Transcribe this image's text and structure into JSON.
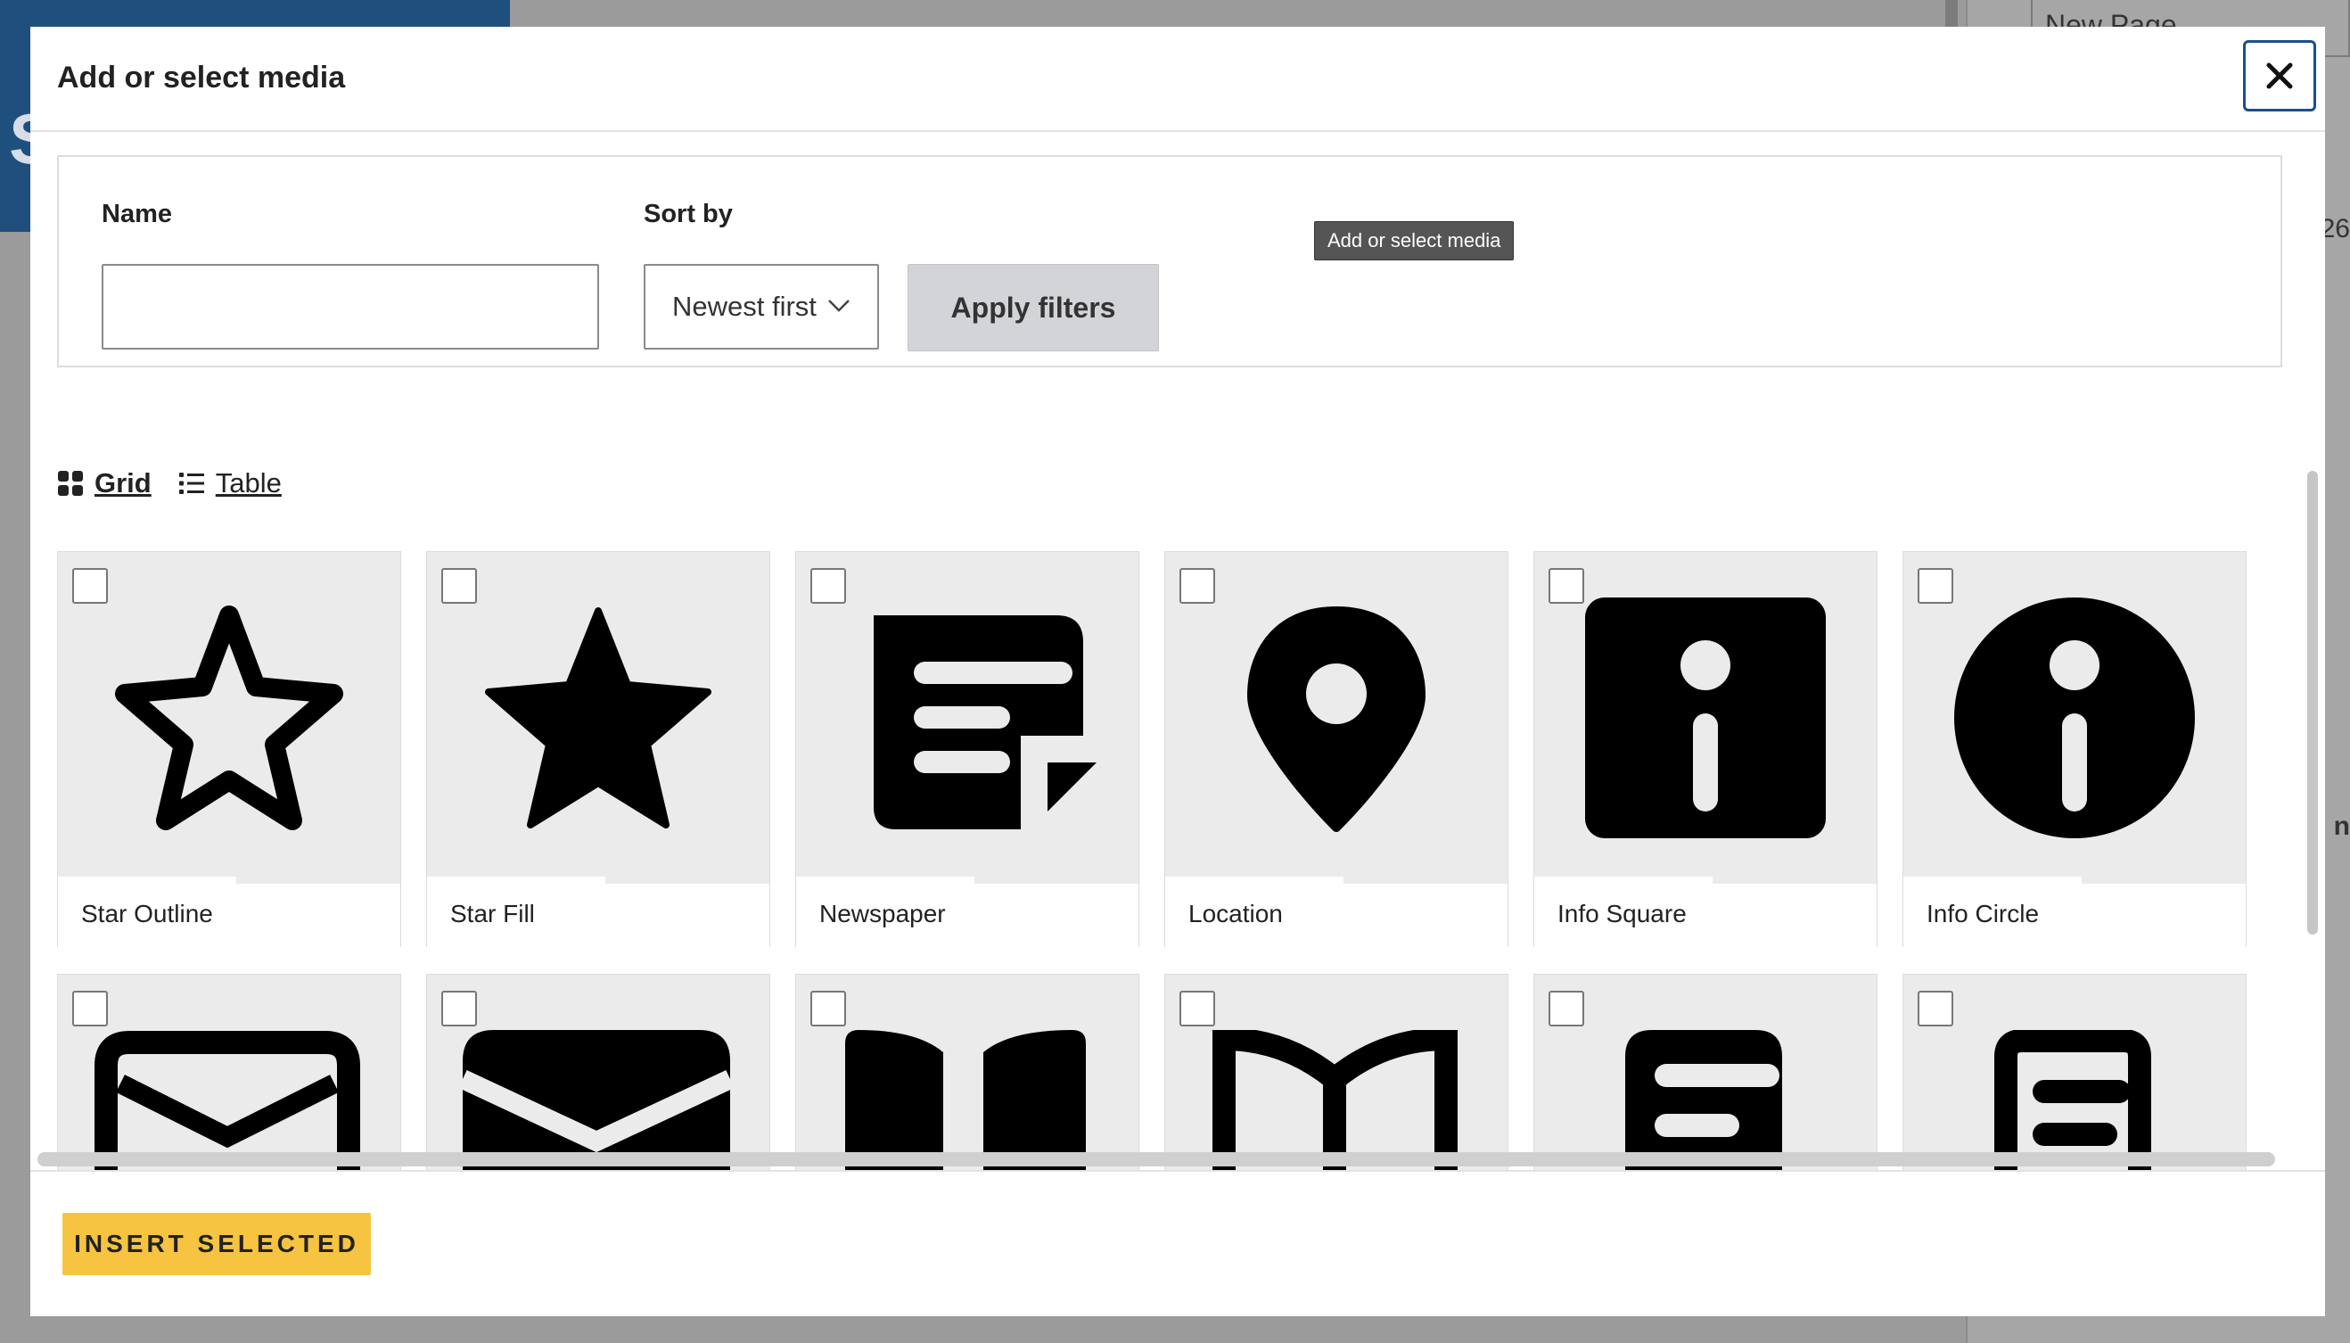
{
  "background": {
    "hero_letter": "S",
    "sidebar_tab": "New Page",
    "number_fragment": "26",
    "letter_fragment": "n"
  },
  "modal": {
    "title": "Add or select media",
    "close_label": "Close"
  },
  "filters": {
    "name_label": "Name",
    "name_value": "",
    "sort_label": "Sort by",
    "sort_value": "Newest first",
    "apply_label": "Apply filters",
    "tooltip": "Add or select media"
  },
  "view": {
    "grid_label": "Grid",
    "table_label": "Table"
  },
  "media_items": [
    {
      "label": "Star Outline",
      "icon": "star-outline-icon"
    },
    {
      "label": "Star Fill",
      "icon": "star-fill-icon"
    },
    {
      "label": "Newspaper",
      "icon": "newspaper-icon"
    },
    {
      "label": "Location",
      "icon": "location-icon"
    },
    {
      "label": "Info Square",
      "icon": "info-square-icon"
    },
    {
      "label": "Info Circle",
      "icon": "info-circle-icon"
    },
    {
      "label": "",
      "icon": "envelope-outline-icon"
    },
    {
      "label": "",
      "icon": "envelope-fill-icon"
    },
    {
      "label": "",
      "icon": "book-fill-icon"
    },
    {
      "label": "",
      "icon": "book-outline-icon"
    },
    {
      "label": "",
      "icon": "document-fill-icon"
    },
    {
      "label": "",
      "icon": "document-outline-icon"
    }
  ],
  "footer": {
    "insert_label": "INSERT SELECTED"
  },
  "colors": {
    "accent_button": "#f6c441",
    "close_border": "#1b4e8f",
    "card_bg": "#ebebeb"
  }
}
